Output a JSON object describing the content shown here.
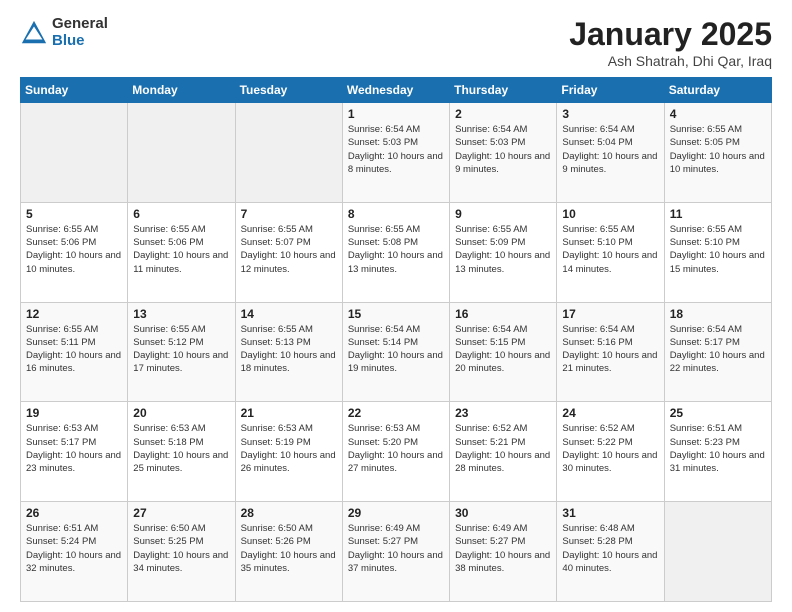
{
  "logo": {
    "general": "General",
    "blue": "Blue"
  },
  "title": "January 2025",
  "subtitle": "Ash Shatrah, Dhi Qar, Iraq",
  "weekdays": [
    "Sunday",
    "Monday",
    "Tuesday",
    "Wednesday",
    "Thursday",
    "Friday",
    "Saturday"
  ],
  "weeks": [
    [
      {
        "day": "",
        "sunrise": "",
        "sunset": "",
        "daylight": ""
      },
      {
        "day": "",
        "sunrise": "",
        "sunset": "",
        "daylight": ""
      },
      {
        "day": "",
        "sunrise": "",
        "sunset": "",
        "daylight": ""
      },
      {
        "day": "1",
        "sunrise": "Sunrise: 6:54 AM",
        "sunset": "Sunset: 5:03 PM",
        "daylight": "Daylight: 10 hours and 8 minutes."
      },
      {
        "day": "2",
        "sunrise": "Sunrise: 6:54 AM",
        "sunset": "Sunset: 5:03 PM",
        "daylight": "Daylight: 10 hours and 9 minutes."
      },
      {
        "day": "3",
        "sunrise": "Sunrise: 6:54 AM",
        "sunset": "Sunset: 5:04 PM",
        "daylight": "Daylight: 10 hours and 9 minutes."
      },
      {
        "day": "4",
        "sunrise": "Sunrise: 6:55 AM",
        "sunset": "Sunset: 5:05 PM",
        "daylight": "Daylight: 10 hours and 10 minutes."
      }
    ],
    [
      {
        "day": "5",
        "sunrise": "Sunrise: 6:55 AM",
        "sunset": "Sunset: 5:06 PM",
        "daylight": "Daylight: 10 hours and 10 minutes."
      },
      {
        "day": "6",
        "sunrise": "Sunrise: 6:55 AM",
        "sunset": "Sunset: 5:06 PM",
        "daylight": "Daylight: 10 hours and 11 minutes."
      },
      {
        "day": "7",
        "sunrise": "Sunrise: 6:55 AM",
        "sunset": "Sunset: 5:07 PM",
        "daylight": "Daylight: 10 hours and 12 minutes."
      },
      {
        "day": "8",
        "sunrise": "Sunrise: 6:55 AM",
        "sunset": "Sunset: 5:08 PM",
        "daylight": "Daylight: 10 hours and 13 minutes."
      },
      {
        "day": "9",
        "sunrise": "Sunrise: 6:55 AM",
        "sunset": "Sunset: 5:09 PM",
        "daylight": "Daylight: 10 hours and 13 minutes."
      },
      {
        "day": "10",
        "sunrise": "Sunrise: 6:55 AM",
        "sunset": "Sunset: 5:10 PM",
        "daylight": "Daylight: 10 hours and 14 minutes."
      },
      {
        "day": "11",
        "sunrise": "Sunrise: 6:55 AM",
        "sunset": "Sunset: 5:10 PM",
        "daylight": "Daylight: 10 hours and 15 minutes."
      }
    ],
    [
      {
        "day": "12",
        "sunrise": "Sunrise: 6:55 AM",
        "sunset": "Sunset: 5:11 PM",
        "daylight": "Daylight: 10 hours and 16 minutes."
      },
      {
        "day": "13",
        "sunrise": "Sunrise: 6:55 AM",
        "sunset": "Sunset: 5:12 PM",
        "daylight": "Daylight: 10 hours and 17 minutes."
      },
      {
        "day": "14",
        "sunrise": "Sunrise: 6:55 AM",
        "sunset": "Sunset: 5:13 PM",
        "daylight": "Daylight: 10 hours and 18 minutes."
      },
      {
        "day": "15",
        "sunrise": "Sunrise: 6:54 AM",
        "sunset": "Sunset: 5:14 PM",
        "daylight": "Daylight: 10 hours and 19 minutes."
      },
      {
        "day": "16",
        "sunrise": "Sunrise: 6:54 AM",
        "sunset": "Sunset: 5:15 PM",
        "daylight": "Daylight: 10 hours and 20 minutes."
      },
      {
        "day": "17",
        "sunrise": "Sunrise: 6:54 AM",
        "sunset": "Sunset: 5:16 PM",
        "daylight": "Daylight: 10 hours and 21 minutes."
      },
      {
        "day": "18",
        "sunrise": "Sunrise: 6:54 AM",
        "sunset": "Sunset: 5:17 PM",
        "daylight": "Daylight: 10 hours and 22 minutes."
      }
    ],
    [
      {
        "day": "19",
        "sunrise": "Sunrise: 6:53 AM",
        "sunset": "Sunset: 5:17 PM",
        "daylight": "Daylight: 10 hours and 23 minutes."
      },
      {
        "day": "20",
        "sunrise": "Sunrise: 6:53 AM",
        "sunset": "Sunset: 5:18 PM",
        "daylight": "Daylight: 10 hours and 25 minutes."
      },
      {
        "day": "21",
        "sunrise": "Sunrise: 6:53 AM",
        "sunset": "Sunset: 5:19 PM",
        "daylight": "Daylight: 10 hours and 26 minutes."
      },
      {
        "day": "22",
        "sunrise": "Sunrise: 6:53 AM",
        "sunset": "Sunset: 5:20 PM",
        "daylight": "Daylight: 10 hours and 27 minutes."
      },
      {
        "day": "23",
        "sunrise": "Sunrise: 6:52 AM",
        "sunset": "Sunset: 5:21 PM",
        "daylight": "Daylight: 10 hours and 28 minutes."
      },
      {
        "day": "24",
        "sunrise": "Sunrise: 6:52 AM",
        "sunset": "Sunset: 5:22 PM",
        "daylight": "Daylight: 10 hours and 30 minutes."
      },
      {
        "day": "25",
        "sunrise": "Sunrise: 6:51 AM",
        "sunset": "Sunset: 5:23 PM",
        "daylight": "Daylight: 10 hours and 31 minutes."
      }
    ],
    [
      {
        "day": "26",
        "sunrise": "Sunrise: 6:51 AM",
        "sunset": "Sunset: 5:24 PM",
        "daylight": "Daylight: 10 hours and 32 minutes."
      },
      {
        "day": "27",
        "sunrise": "Sunrise: 6:50 AM",
        "sunset": "Sunset: 5:25 PM",
        "daylight": "Daylight: 10 hours and 34 minutes."
      },
      {
        "day": "28",
        "sunrise": "Sunrise: 6:50 AM",
        "sunset": "Sunset: 5:26 PM",
        "daylight": "Daylight: 10 hours and 35 minutes."
      },
      {
        "day": "29",
        "sunrise": "Sunrise: 6:49 AM",
        "sunset": "Sunset: 5:27 PM",
        "daylight": "Daylight: 10 hours and 37 minutes."
      },
      {
        "day": "30",
        "sunrise": "Sunrise: 6:49 AM",
        "sunset": "Sunset: 5:27 PM",
        "daylight": "Daylight: 10 hours and 38 minutes."
      },
      {
        "day": "31",
        "sunrise": "Sunrise: 6:48 AM",
        "sunset": "Sunset: 5:28 PM",
        "daylight": "Daylight: 10 hours and 40 minutes."
      },
      {
        "day": "",
        "sunrise": "",
        "sunset": "",
        "daylight": ""
      }
    ]
  ]
}
